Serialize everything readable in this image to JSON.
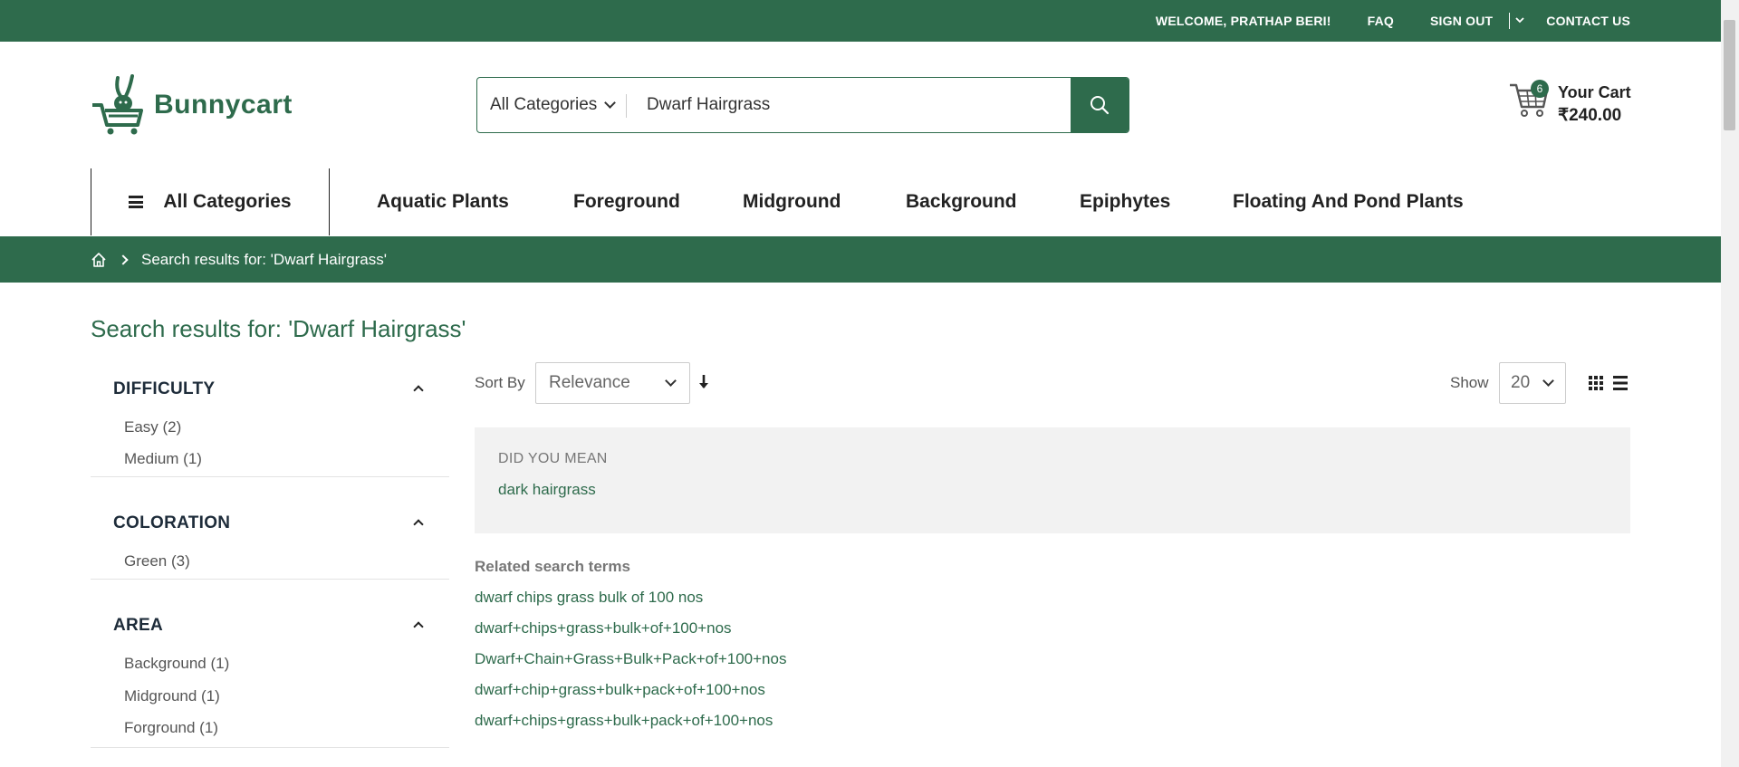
{
  "topbar": {
    "welcome": "WELCOME, PRATHAP BERI!",
    "faq": "FAQ",
    "sign_out": "SIGN OUT",
    "contact": "CONTACT US"
  },
  "brand": {
    "name": "Bunnycart",
    "color": "#2e6b4c"
  },
  "search": {
    "category": "All Categories",
    "value": "Dwarf Hairgrass",
    "button_icon": "search-icon"
  },
  "cart": {
    "count": "6",
    "label": "Your Cart",
    "amount": "₹240.00"
  },
  "nav": {
    "all_categories": "All Categories",
    "items": [
      "Aquatic Plants",
      "Foreground",
      "Midground",
      "Background",
      "Epiphytes",
      "Floating And Pond Plants"
    ]
  },
  "breadcrumb": {
    "current": "Search results for: 'Dwarf Hairgrass'"
  },
  "page_title": "Search results for: 'Dwarf Hairgrass'",
  "filters": [
    {
      "title": "DIFFICULTY",
      "options": [
        "Easy (2)",
        "Medium (1)"
      ]
    },
    {
      "title": "COLORATION",
      "options": [
        "Green (3)"
      ]
    },
    {
      "title": "AREA",
      "options": [
        "Background (1)",
        "Midground (1)",
        "Forground (1)"
      ]
    }
  ],
  "toolbar": {
    "sort_label": "Sort By",
    "sort_value": "Relevance",
    "show_label": "Show",
    "show_value": "20"
  },
  "did_you_mean": {
    "title": "DID YOU MEAN",
    "suggestion": "dark hairgrass"
  },
  "related": {
    "title": "Related search terms",
    "terms": [
      "dwarf chips grass bulk of 100 nos",
      "dwarf+chips+grass+bulk+of+100+nos",
      "Dwarf+Chain+Grass+Bulk+Pack+of+100+nos",
      "dwarf+chip+grass+bulk+pack+of+100+nos",
      "dwarf+chips+grass+bulk+pack+of+100+nos"
    ]
  }
}
